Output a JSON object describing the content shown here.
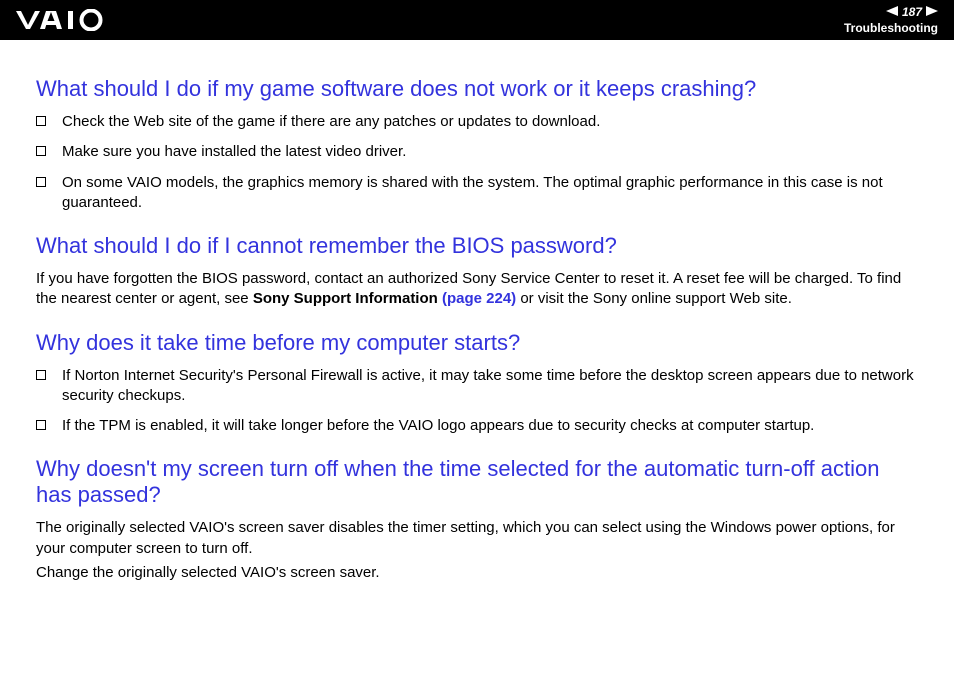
{
  "header": {
    "page_number": "187",
    "section": "Troubleshooting"
  },
  "sections": [
    {
      "heading": "What should I do if my game software does not work or it keeps crashing?",
      "bullets": [
        "Check the Web site of the game if there are any patches or updates to download.",
        "Make sure you have installed the latest video driver.",
        "On some VAIO models, the graphics memory is shared with the system. The optimal graphic performance in this case is not guaranteed."
      ]
    },
    {
      "heading": "What should I do if I cannot remember the BIOS password?",
      "para_before": "If you have forgotten the BIOS password, contact an authorized Sony Service Center to reset it. A reset fee will be charged. To find the nearest center or agent, see ",
      "link_bold": "Sony Support Information ",
      "link_page": "(page 224)",
      "para_after": " or visit the Sony online support Web site."
    },
    {
      "heading": "Why does it take time before my computer starts?",
      "bullets": [
        "If Norton Internet Security's Personal Firewall is active, it may take some time before the desktop screen appears due to network security checkups.",
        "If the TPM is enabled, it will take longer before the VAIO logo appears due to security checks at computer startup."
      ]
    },
    {
      "heading": "Why doesn't my screen turn off when the time selected for the automatic turn-off action has passed?",
      "para1": "The originally selected VAIO's screen saver disables the timer setting, which you can select using the Windows power options, for your computer screen to turn off.",
      "para2": "Change the originally selected VAIO's screen saver."
    }
  ]
}
